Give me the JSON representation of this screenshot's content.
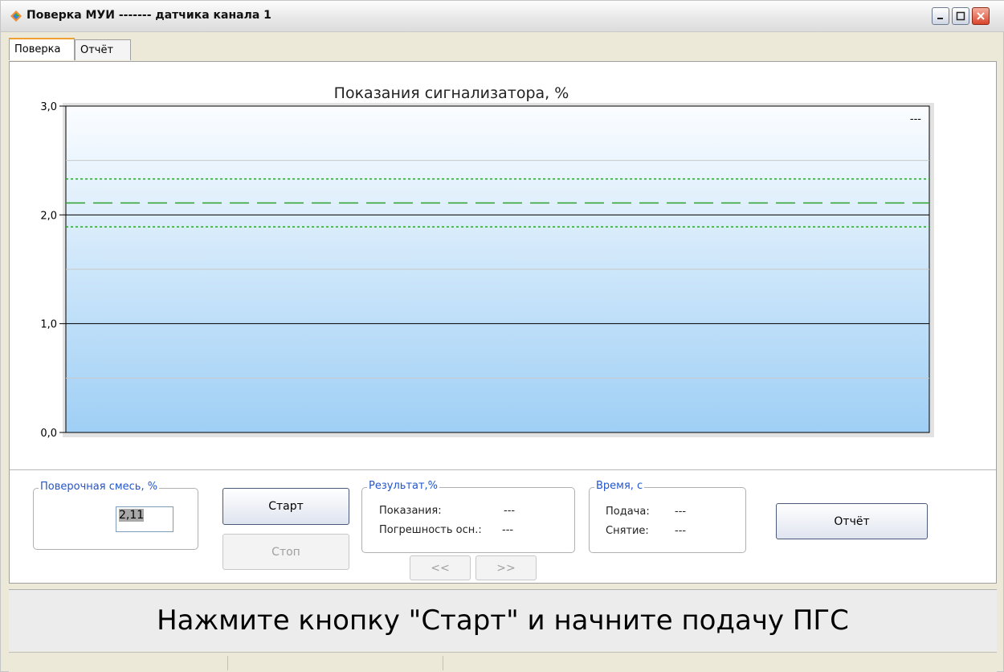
{
  "window": {
    "title": "Поверка МУИ ------- датчика канала 1",
    "minimize_label": "_",
    "maximize_label": "□",
    "close_label": "✕"
  },
  "tabs": [
    {
      "label": "Поверка",
      "active": true
    },
    {
      "label": "Отчёт",
      "active": false
    }
  ],
  "chart": {
    "title": "Показания сигнализатора, %",
    "legend_text": "---"
  },
  "chart_data": {
    "type": "line",
    "title": "Показания сигнализатора, %",
    "xlabel": "",
    "ylabel": "",
    "ylim": [
      0,
      3
    ],
    "y_tick_labels": [
      "3,0",
      "2,0",
      "1,0",
      "0,0"
    ],
    "y_ticks": [
      3,
      2,
      1,
      0
    ],
    "minor_grid": [
      0.5,
      1.5,
      2.5
    ],
    "reference_lines": {
      "target": 2.11,
      "upper_limit": 2.33,
      "lower_limit": 1.89
    },
    "series": [],
    "grid": true
  },
  "mix_group": {
    "legend": "Поверочная смесь, %",
    "value": "2,11"
  },
  "buttons": {
    "start": "Старт",
    "stop": "Стоп",
    "prev": "<<",
    "next": ">>",
    "report": "Отчёт"
  },
  "result_group": {
    "legend": "Результат,%",
    "readings_label": "Показания:",
    "readings_value": "---",
    "error_label": "Погрешность осн.:",
    "error_value": "---"
  },
  "time_group": {
    "legend": "Время, с",
    "supply_label": "Подача:",
    "supply_value": "---",
    "removal_label": "Снятие:",
    "removal_value": "---"
  },
  "status": {
    "message": "Нажмите кнопку \"Старт\" и начните подачу ПГС"
  },
  "colors": {
    "limit_line": "#2aa02a",
    "plot_top": "#fbfdff",
    "plot_bottom": "#9fcff5",
    "group_legend": "#2255cc"
  }
}
